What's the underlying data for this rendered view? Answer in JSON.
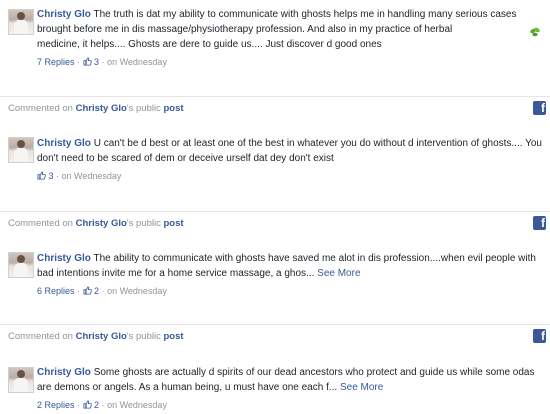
{
  "comments": [
    {
      "author": "Christy Glo",
      "text": "The truth is dat my ability to communicate with ghosts helps me in handling many serious cases brought before me in dis massage/physiotherapy profession. And also in my practice of herbal",
      "text2": "medicine, it helps.... Ghosts are dere to guide us.... Just discover d good ones",
      "replies": "7 Replies",
      "likes": "3",
      "time": "on Wednesday",
      "emoji": "herb-icon"
    },
    {
      "author": "Christy Glo",
      "text": "U can't be d best or at least one of the best in whatever you do without d intervention of ghosts.... You don't need to be scared of dem or deceive urself dat dey don't exist",
      "likes": "3",
      "time": "on Wednesday"
    },
    {
      "author": "Christy Glo",
      "text": "The ability to communicate with ghosts have saved me alot in dis profession....when evil people with bad intentions invite me for a home service massage, a ghos...",
      "see_more": "See More",
      "replies": "6 Replies",
      "likes": "2",
      "time": "on Wednesday"
    },
    {
      "author": "Christy Glo",
      "text": "Some ghosts are actually d spirits of our dead ancestors who protect and guide us while some odas are demons or angels. As a human being, u must have one each f...",
      "see_more": "See More",
      "replies": "2 Replies",
      "likes": "2",
      "time": "on Wednesday"
    }
  ],
  "headers": [
    {
      "prefix": "Commented on",
      "name": "Christy Glo",
      "mid": "'s public",
      "post": "post"
    },
    {
      "prefix": "Commented on",
      "name": "Christy Glo",
      "mid": "'s public",
      "post": "post"
    },
    {
      "prefix": "Commented on",
      "name": "Christy Glo",
      "mid": "'s public",
      "post": "post"
    }
  ],
  "separator": " · ",
  "icons": {
    "facebook": "facebook-icon",
    "like": "thumbs-up-icon"
  },
  "colors": {
    "link": "#385898",
    "meta": "#90949c",
    "facebook": "#3b5998"
  }
}
